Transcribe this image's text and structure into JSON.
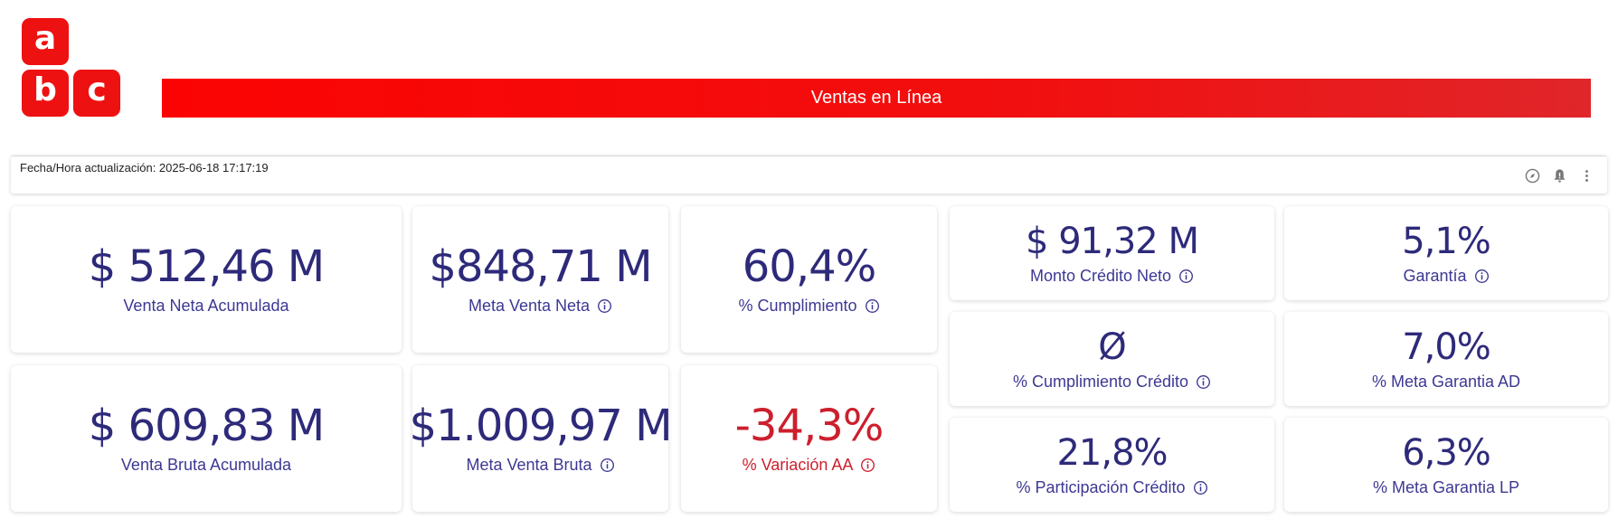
{
  "logo": {
    "letters": [
      "a",
      "b",
      "c"
    ],
    "color": "#ee1111"
  },
  "header": {
    "title": "Ventas en Línea",
    "color": "#f20f0f"
  },
  "update": {
    "text": "Fecha/Hora actualización: 2025-06-18 17:17:19"
  },
  "toolbar_icons": [
    "compass-icon",
    "alert-bell-icon",
    "more-vertical-icon"
  ],
  "kpis": {
    "venta_neta": {
      "value": "$ 512,46 M",
      "label": "Venta Neta Acumulada"
    },
    "venta_bruta": {
      "value": "$ 609,83 M",
      "label": "Venta Bruta Acumulada"
    },
    "meta_neta": {
      "value": "$848,71 M",
      "label": "Meta Venta Neta"
    },
    "meta_bruta": {
      "value": "$1.009,97 M",
      "label": "Meta Venta Bruta"
    },
    "cumplimiento": {
      "value": "60,4%",
      "label": "% Cumplimiento"
    },
    "variacion": {
      "value": "-34,3%",
      "label": "% Variación AA",
      "color": "#cc1f2d"
    },
    "monto_credito": {
      "value": "$ 91,32 M",
      "label": "Monto Crédito Neto"
    },
    "cumplimiento_credito": {
      "value": "Ø",
      "label": "% Cumplimiento Crédito"
    },
    "participacion_credito": {
      "value": "21,8%",
      "label": "% Participación Crédito"
    },
    "garantia": {
      "value": "5,1%",
      "label": "Garantía"
    },
    "meta_garantia_ad": {
      "value": "7,0%",
      "label": "% Meta Garantia AD"
    },
    "meta_garantia_lp": {
      "value": "6,3%",
      "label": "% Meta Garantia LP"
    }
  },
  "colors": {
    "value_text": "#2e2a7a",
    "label_text": "#3d3893",
    "negative": "#cc1f2d"
  }
}
